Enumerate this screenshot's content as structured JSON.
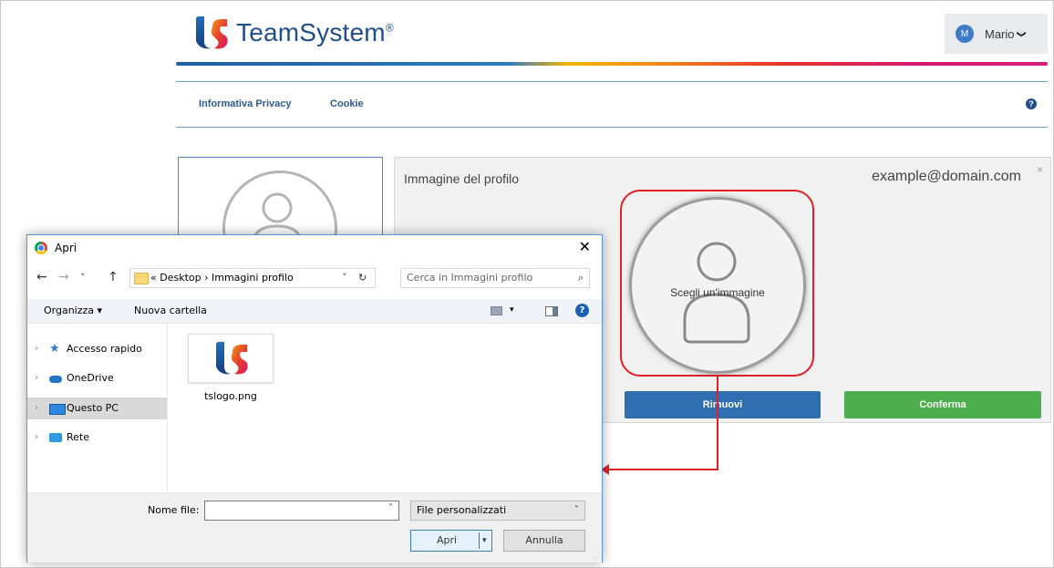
{
  "header": {
    "brand": "TeamSystem",
    "brand_mark": "®",
    "user_initial": "M",
    "user_name": "Mario",
    "user_caret": "❯"
  },
  "nav": {
    "links": [
      "Informativa Privacy",
      "Cookie"
    ],
    "help_icon": "?"
  },
  "profile_panel": {
    "title": "Immagine del profilo",
    "email": "example@domain.com",
    "close": "×",
    "choose_image_label": "Scegli un'immagine",
    "remove_label": "Rimuovi",
    "confirm_label": "Conferma"
  },
  "colors": {
    "brand_blue": "#1f4e8c",
    "remove_button": "#2f6fb1",
    "confirm_button": "#4cae4c",
    "highlight": "#e51f27"
  },
  "dialog": {
    "title": "Apri",
    "close": "✕",
    "nav": {
      "back": "←",
      "forward": "→",
      "recent": "˅",
      "up": "↑"
    },
    "address": "« Desktop › Immagini profilo",
    "address_dropdown": "˅",
    "refresh": "↻",
    "search_placeholder": "Cerca in Immagini profilo",
    "toolbar": {
      "organize": "Organizza ▾",
      "new_folder": "Nuova cartella",
      "view_caret": "▾",
      "help": "?"
    },
    "sidebar": [
      {
        "label": "Accesso rapido",
        "icon": "star-icon",
        "selected": false
      },
      {
        "label": "OneDrive",
        "icon": "cloud-icon",
        "selected": false
      },
      {
        "label": "Questo PC",
        "icon": "computer-icon",
        "selected": true
      },
      {
        "label": "Rete",
        "icon": "network-icon",
        "selected": false
      }
    ],
    "sidebar_chevron": "›",
    "files": [
      {
        "name": "tslogo.png"
      }
    ],
    "filename_label": "Nome file:",
    "filename_value": "",
    "filename_dropdown": "˅",
    "filetype": "File personalizzati",
    "filetype_dropdown": "˅",
    "open_label": "Apri",
    "open_caret": "▾",
    "cancel_label": "Annulla"
  }
}
